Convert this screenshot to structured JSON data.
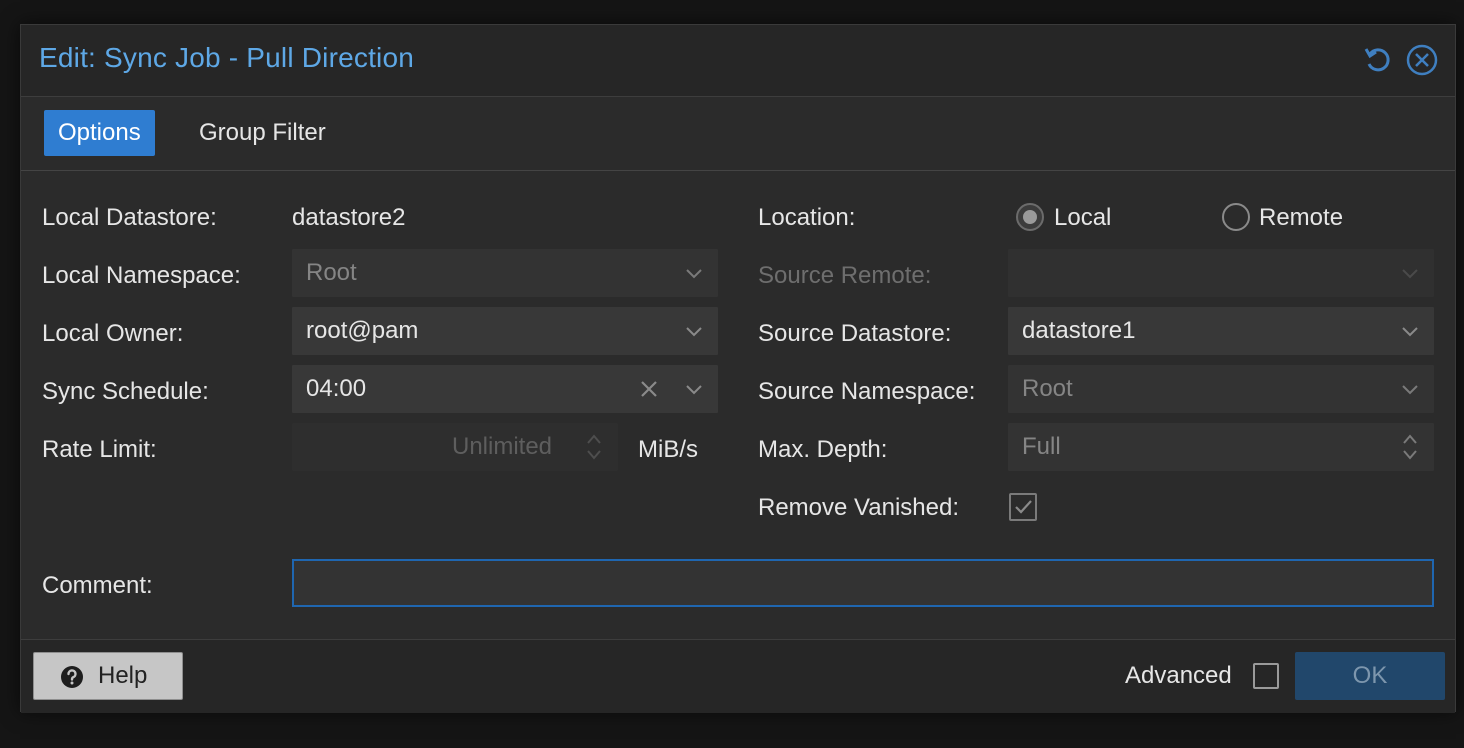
{
  "dialog": {
    "title": "Edit: Sync Job - Pull Direction"
  },
  "tabs": [
    {
      "label": "Options",
      "active": true
    },
    {
      "label": "Group Filter",
      "active": false
    }
  ],
  "left": {
    "local_datastore": {
      "label": "Local Datastore:",
      "value": "datastore2"
    },
    "local_namespace": {
      "label": "Local Namespace:",
      "value": "Root"
    },
    "local_owner": {
      "label": "Local Owner:",
      "value": "root@pam"
    },
    "sync_schedule": {
      "label": "Sync Schedule:",
      "value": "04:00"
    },
    "rate_limit": {
      "label": "Rate Limit:",
      "placeholder": "Unlimited",
      "unit": "MiB/s"
    }
  },
  "right": {
    "location": {
      "label": "Location:",
      "options": [
        "Local",
        "Remote"
      ],
      "selected": "Local"
    },
    "source_remote": {
      "label": "Source Remote:",
      "value": ""
    },
    "source_datastore": {
      "label": "Source Datastore:",
      "value": "datastore1"
    },
    "source_namespace": {
      "label": "Source Namespace:",
      "value": "Root"
    },
    "max_depth": {
      "label": "Max. Depth:",
      "value": "Full"
    },
    "remove_vanished": {
      "label": "Remove Vanished:",
      "checked": true
    }
  },
  "comment": {
    "label": "Comment:",
    "value": ""
  },
  "footer": {
    "help_label": "Help",
    "advanced_label": "Advanced",
    "advanced_checked": false,
    "ok_label": "OK"
  },
  "colors": {
    "accent": "#2f7dd1",
    "title": "#5ea8e6",
    "background": "#2b2b2b"
  }
}
